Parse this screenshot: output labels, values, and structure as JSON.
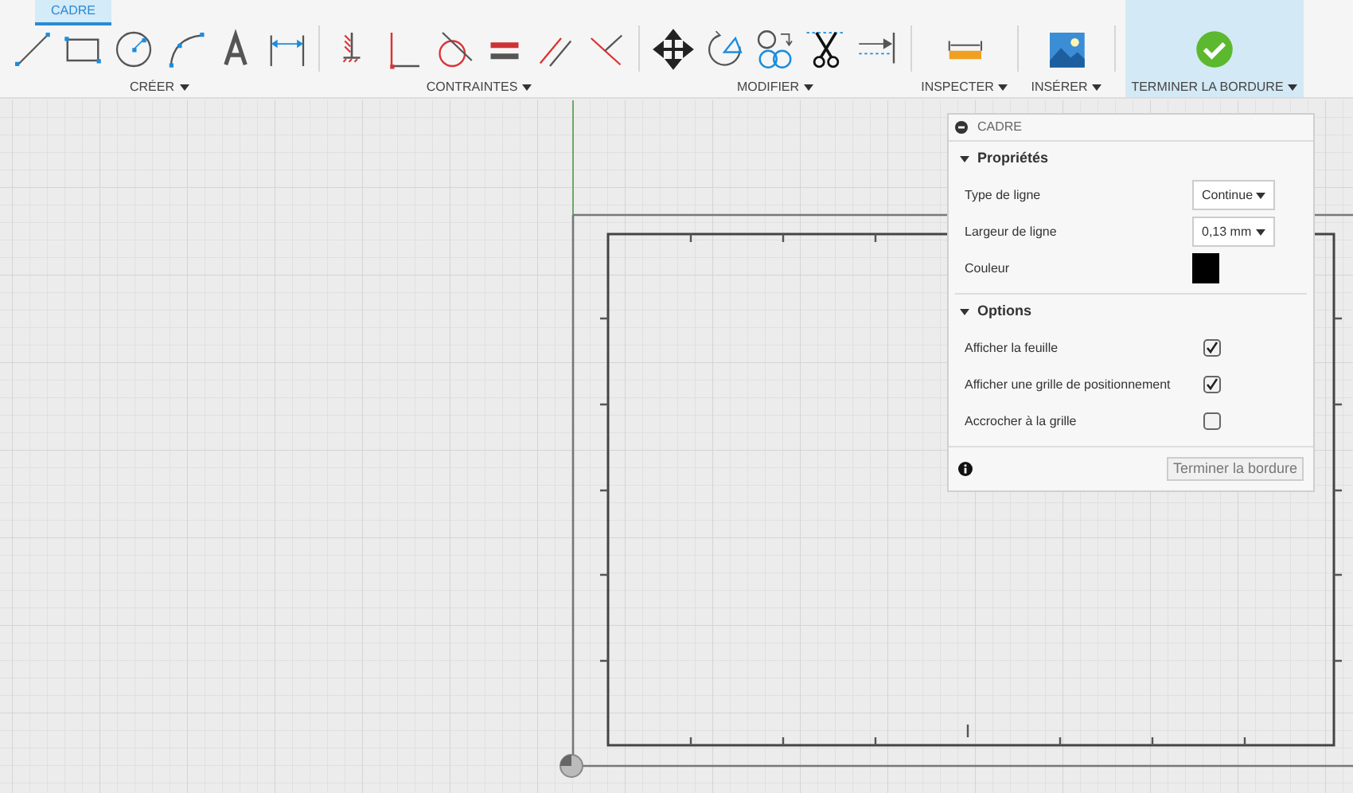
{
  "tabs": [
    {
      "label": "CADRE",
      "selected": true
    }
  ],
  "groups": [
    {
      "label": "CRÉER",
      "highlighted": false,
      "tools": [
        {
          "kind": "line"
        },
        {
          "kind": "rectangle"
        },
        {
          "kind": "circle"
        },
        {
          "kind": "arc"
        },
        {
          "kind": "text"
        },
        {
          "kind": "dimension"
        }
      ]
    },
    {
      "label": "CONTRAINTES",
      "highlighted": false,
      "tools": [
        {
          "kind": "fix"
        },
        {
          "kind": "perpendicular"
        },
        {
          "kind": "tangent"
        },
        {
          "kind": "equal"
        },
        {
          "kind": "parallel"
        },
        {
          "kind": "angle"
        }
      ]
    },
    {
      "label": "MODIFIER",
      "highlighted": false,
      "tools": [
        {
          "kind": "move"
        },
        {
          "kind": "rotate"
        },
        {
          "kind": "offset"
        },
        {
          "kind": "trim"
        },
        {
          "kind": "extend"
        }
      ]
    },
    {
      "label": "INSPECTER",
      "highlighted": false,
      "tools": [
        {
          "kind": "measure"
        }
      ]
    },
    {
      "label": "INSÉRER",
      "highlighted": false,
      "tools": [
        {
          "kind": "image"
        }
      ]
    },
    {
      "label": "TERMINER LA BORDURE",
      "highlighted": true,
      "tools": [
        {
          "kind": "finish"
        }
      ]
    }
  ],
  "panel": {
    "title": "CADRE",
    "sections": [
      {
        "title": "Propriétés",
        "expanded": true,
        "rows": [
          {
            "kind": "dropdown",
            "label": "Type de ligne",
            "value": "Continue"
          },
          {
            "kind": "dropdown",
            "label": "Largeur de ligne",
            "value": "0,13 mm"
          },
          {
            "kind": "color",
            "label": "Couleur",
            "color": "#000000"
          }
        ]
      },
      {
        "title": "Options",
        "expanded": true,
        "rows": [
          {
            "kind": "checkbox",
            "label": "Afficher la feuille",
            "checked": true
          },
          {
            "kind": "checkbox",
            "label": "Afficher une grille de positionnement",
            "checked": true
          },
          {
            "kind": "checkbox",
            "label": "Accrocher à la grille",
            "checked": false
          }
        ]
      }
    ],
    "button": "Terminer la bordure"
  }
}
